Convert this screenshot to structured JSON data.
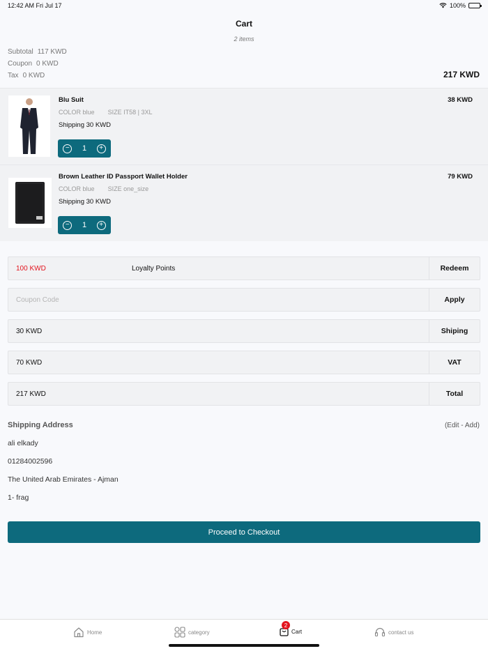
{
  "status_bar": {
    "time": "12:42 AM  Fri Jul 17",
    "battery": "100%"
  },
  "header": {
    "title": "Cart",
    "subtitle": "2 items"
  },
  "summary": {
    "subtotal_label": "Subtotal",
    "subtotal_value": "117 KWD",
    "coupon_label": "Coupon",
    "coupon_value": "0 KWD",
    "tax_label": "Tax",
    "tax_value": "0 KWD",
    "total": "217 KWD"
  },
  "items": [
    {
      "name": "Blu Suit",
      "price": "38 KWD",
      "color_label": "COLOR",
      "color_value": "blue",
      "size_label": "SIZE",
      "size_value": "IT58 | 3XL",
      "shipping_label": "Shipping",
      "shipping_value": "30 KWD",
      "quantity": "1"
    },
    {
      "name": "Brown Leather ID Passport Wallet Holder",
      "price": "79 KWD",
      "color_label": "COLOR",
      "color_value": "blue",
      "size_label": "SIZE",
      "size_value": "one_size",
      "shipping_label": "Shipping",
      "shipping_value": "30 KWD",
      "quantity": "1"
    }
  ],
  "loyalty": {
    "amount": "100 KWD",
    "label": "Loyalty Points",
    "action": "Redeem"
  },
  "coupon": {
    "placeholder": "Coupon Code",
    "value": "",
    "action": "Apply"
  },
  "shipping_row": {
    "value": "30 KWD",
    "label": "Shiping"
  },
  "vat_row": {
    "value": "70 KWD",
    "label": "VAT"
  },
  "total_row": {
    "value": "217 KWD",
    "label": "Total"
  },
  "address": {
    "heading": "Shipping Address",
    "edit": "(Edit - Add)",
    "name": "ali elkady",
    "phone": "01284002596",
    "location": "The United Arab Emirates -  Ajman",
    "street": "1-  frag"
  },
  "checkout_label": "Proceed to Checkout",
  "tabbar": {
    "home": "Home",
    "category": "category",
    "cart": "Cart",
    "contact": "contact us",
    "cart_badge": "2"
  },
  "colors": {
    "accent": "#0d6a7d",
    "loyalty_red": "#e3141e"
  }
}
